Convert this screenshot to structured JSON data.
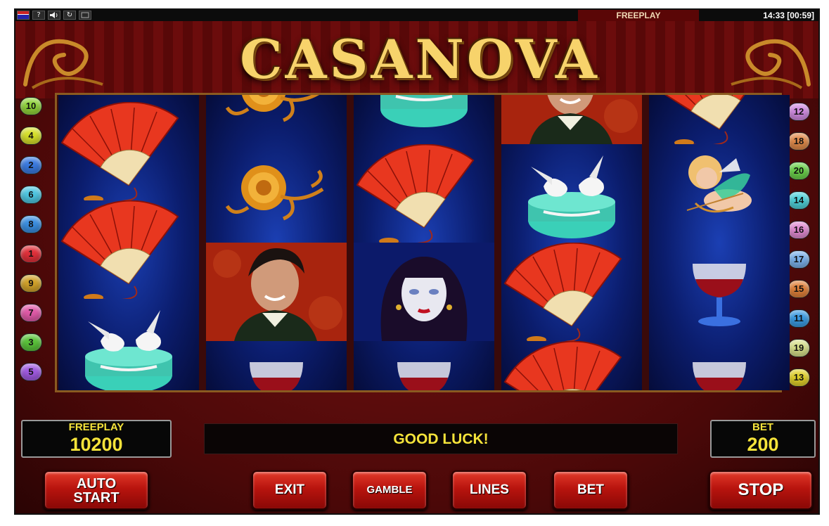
{
  "game": {
    "title": "CASANOVA"
  },
  "top_bar": {
    "mode": "FREEPLAY",
    "clock": "14:33 [00:59]",
    "help_icon": "?",
    "reload_icon": "↻"
  },
  "lines_left": [
    {
      "label": "10",
      "color": "#8fd33a"
    },
    {
      "label": "4",
      "color": "#d6df2a"
    },
    {
      "label": "2",
      "color": "#3a7ae0"
    },
    {
      "label": "6",
      "color": "#4ec6e0"
    },
    {
      "label": "8",
      "color": "#3a8ee0"
    },
    {
      "label": "1",
      "color": "#e0303a"
    },
    {
      "label": "9",
      "color": "#d1a22a"
    },
    {
      "label": "7",
      "color": "#e05aa8"
    },
    {
      "label": "3",
      "color": "#5ac33a"
    },
    {
      "label": "5",
      "color": "#a05ae0"
    }
  ],
  "lines_right": [
    {
      "label": "12",
      "color": "#d08ae0"
    },
    {
      "label": "18",
      "color": "#e08a4a"
    },
    {
      "label": "20",
      "color": "#6ad04a"
    },
    {
      "label": "14",
      "color": "#4ed0d8"
    },
    {
      "label": "16",
      "color": "#e08ad0"
    },
    {
      "label": "17",
      "color": "#7ab0e8"
    },
    {
      "label": "15",
      "color": "#e0803a"
    },
    {
      "label": "11",
      "color": "#3a9ae0"
    },
    {
      "label": "19",
      "color": "#d6df8a"
    },
    {
      "label": "13",
      "color": "#e0d02a"
    }
  ],
  "reels": [
    [
      "fan",
      "fan",
      "doves"
    ],
    [
      "rose",
      "rose",
      "casanova",
      "wine"
    ],
    [
      "box",
      "fan",
      "lady",
      "wine"
    ],
    [
      "casanova",
      "doves",
      "fan",
      "fan"
    ],
    [
      "fan",
      "cupid",
      "wine",
      "wine"
    ]
  ],
  "status": {
    "credit_label": "FREEPLAY",
    "credit_value": "10200",
    "message": "GOOD LUCK!",
    "bet_label": "BET",
    "bet_value": "200"
  },
  "buttons": {
    "autostart_line1": "AUTO",
    "autostart_line2": "START",
    "exit": "EXIT",
    "gamble": "GAMBLE",
    "lines": "LINES",
    "bet": "BET",
    "stop": "STOP"
  }
}
